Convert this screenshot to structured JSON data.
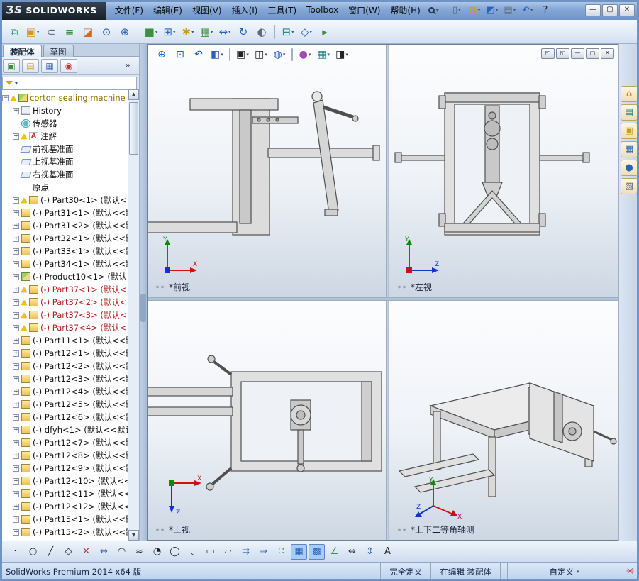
{
  "titlebar": {
    "logo_mark": "ƷS",
    "logo_text": "SOLIDWORKS",
    "menus": [
      {
        "label": "文件(F)"
      },
      {
        "label": "编辑(E)"
      },
      {
        "label": "视图(V)"
      },
      {
        "label": "插入(I)"
      },
      {
        "label": "工具(T)"
      },
      {
        "label": "Toolbox"
      },
      {
        "label": "窗口(W)"
      },
      {
        "label": "帮助(H)"
      }
    ],
    "quick_icons": [
      {
        "name": "new-document-icon",
        "g": "▯",
        "cls": "c-gray dd"
      },
      {
        "name": "open-icon",
        "g": "▥",
        "cls": "c-yellow dd"
      },
      {
        "name": "save-icon",
        "g": "◩",
        "cls": "c-blue dd"
      },
      {
        "name": "print-icon",
        "g": "▤",
        "cls": "c-gray dd"
      },
      {
        "name": "undo-icon",
        "g": "↶",
        "cls": "c-blue dd"
      },
      {
        "name": "help-icon",
        "g": "?",
        "cls": "c-dark"
      }
    ],
    "window_controls": [
      {
        "name": "minimize-button",
        "g": "—"
      },
      {
        "name": "maximize-button",
        "g": "▢"
      },
      {
        "name": "close-button",
        "g": "✕"
      }
    ]
  },
  "toolbar": {
    "icons": [
      {
        "name": "window-cascade-icon",
        "g": "⧉",
        "cls": "c-teal"
      },
      {
        "name": "open-folder-icon",
        "g": "▣",
        "cls": "c-yellow dd"
      },
      {
        "name": "attach-icon",
        "g": "⊂",
        "cls": "c-gray"
      },
      {
        "name": "external-references-icon",
        "g": "≡",
        "cls": "c-green"
      },
      {
        "name": "edit-component-icon",
        "g": "◪",
        "cls": "c-orange"
      },
      {
        "name": "find-references-icon",
        "g": "⊙",
        "cls": "c-blue"
      },
      {
        "name": "search-doc-icon",
        "g": "⊕",
        "cls": "c-blue"
      },
      {
        "name": "separator",
        "g": "",
        "cls": "sep"
      },
      {
        "name": "insert-components-icon",
        "g": "■",
        "cls": "c-green dd"
      },
      {
        "name": "mate-icon",
        "g": "⊞",
        "cls": "c-blue dd"
      },
      {
        "name": "smart-fasteners-icon",
        "g": "✱",
        "cls": "c-yellow dd"
      },
      {
        "name": "component-pattern-icon",
        "g": "▦",
        "cls": "c-green dd"
      },
      {
        "name": "move-component-icon",
        "g": "↔",
        "cls": "c-blue dd"
      },
      {
        "name": "rotate-component-icon",
        "g": "↻",
        "cls": "c-blue"
      },
      {
        "name": "show-hidden-components-icon",
        "g": "◐",
        "cls": "c-gray"
      },
      {
        "name": "separator",
        "g": "",
        "cls": "sep"
      },
      {
        "name": "assembly-features-icon",
        "g": "⊟",
        "cls": "c-teal dd"
      },
      {
        "name": "reference-geometry-icon",
        "g": "◇",
        "cls": "c-blue dd"
      },
      {
        "name": "motion-study-icon",
        "g": "▸",
        "cls": "c-green"
      }
    ]
  },
  "panel": {
    "tabs": [
      {
        "label": "装配体",
        "cls": "active"
      },
      {
        "label": "草图",
        "cls": ""
      }
    ],
    "header_icons": [
      {
        "name": "featuremanager-tab-icon",
        "g": "▣",
        "cls": "c-green"
      },
      {
        "name": "propertymanager-tab-icon",
        "g": "▤",
        "cls": "c-yellow"
      },
      {
        "name": "configurationmanager-tab-icon",
        "g": "▦",
        "cls": "c-blue"
      },
      {
        "name": "dimxpertmanager-tab-icon",
        "g": "◉",
        "cls": "c-red"
      },
      {
        "name": "chevron-right-icon",
        "g": "»",
        "cls": "chev"
      }
    ],
    "tree": {
      "items": [
        {
          "label": "corton sealing machine",
          "cls": "i-asmroot warn root exp"
        },
        {
          "label": "History",
          "cls": "i-history exp"
        },
        {
          "label": "传感器",
          "cls": "i-sensor"
        },
        {
          "label": "注解",
          "cls": "i-ann warn exp"
        },
        {
          "label": "前视基准面",
          "cls": "i-plane"
        },
        {
          "label": "上视基准面",
          "cls": "i-plane"
        },
        {
          "label": "右视基准面",
          "cls": "i-plane"
        },
        {
          "label": "原点",
          "cls": "i-origin"
        },
        {
          "label": "(-) Part30<1> (默认<",
          "cls": "i-part warn exp"
        },
        {
          "label": "(-) Part31<1> (默认<<默",
          "cls": "i-part exp"
        },
        {
          "label": "(-) Part31<2> (默认<<默",
          "cls": "i-part exp"
        },
        {
          "label": "(-) Part32<1> (默认<<默",
          "cls": "i-part exp"
        },
        {
          "label": "(-) Part33<1> (默认<<默",
          "cls": "i-part exp"
        },
        {
          "label": "(-) Part34<1> (默认<<默",
          "cls": "i-part exp"
        },
        {
          "label": "(-) Product10<1> (默认<",
          "cls": "i-asm exp"
        },
        {
          "label": "(-) Part37<1> (默认<",
          "cls": "i-part warn red exp"
        },
        {
          "label": "(-) Part37<2> (默认<",
          "cls": "i-part warn red exp"
        },
        {
          "label": "(-) Part37<3> (默认<",
          "cls": "i-part warn red exp"
        },
        {
          "label": "(-) Part37<4> (默认<",
          "cls": "i-part warn red exp"
        },
        {
          "label": "(-) Part11<1> (默认<<默",
          "cls": "i-part exp"
        },
        {
          "label": "(-) Part12<1> (默认<<默",
          "cls": "i-part exp"
        },
        {
          "label": "(-) Part12<2> (默认<<默",
          "cls": "i-part exp"
        },
        {
          "label": "(-) Part12<3> (默认<<默",
          "cls": "i-part exp"
        },
        {
          "label": "(-) Part12<4> (默认<<默",
          "cls": "i-part exp"
        },
        {
          "label": "(-) Part12<5> (默认<<默",
          "cls": "i-part exp"
        },
        {
          "label": "(-) Part12<6> (默认<<默",
          "cls": "i-part exp"
        },
        {
          "label": "(-) dfyh<1> (默认<<默认",
          "cls": "i-part exp"
        },
        {
          "label": "(-) Part12<7> (默认<<默",
          "cls": "i-part exp"
        },
        {
          "label": "(-) Part12<8> (默认<<默",
          "cls": "i-part exp"
        },
        {
          "label": "(-) Part12<9> (默认<<默",
          "cls": "i-part exp"
        },
        {
          "label": "(-) Part12<10> (默认<<",
          "cls": "i-part exp"
        },
        {
          "label": "(-) Part12<11> (默认<<",
          "cls": "i-part exp"
        },
        {
          "label": "(-) Part12<12> (默认<<",
          "cls": "i-part exp"
        },
        {
          "label": "(-) Part15<1> (默认<<默",
          "cls": "i-part exp"
        },
        {
          "label": "(-) Part15<2> (默认<<默",
          "cls": "i-part exp"
        }
      ]
    }
  },
  "headsup": [
    {
      "name": "zoom-fit-icon",
      "g": "⊕",
      "cls": "c-blue"
    },
    {
      "name": "zoom-area-icon",
      "g": "⊡",
      "cls": "c-blue"
    },
    {
      "name": "previous-view-icon",
      "g": "↶",
      "cls": "c-blue"
    },
    {
      "name": "section-view-icon",
      "g": "◧",
      "cls": "c-blue dd"
    },
    {
      "name": "separator",
      "g": "",
      "cls": "sep"
    },
    {
      "name": "view-orientation-icon",
      "g": "▣",
      "cls": "c-dark dd"
    },
    {
      "name": "display-style-icon",
      "g": "◫",
      "cls": "c-dark dd"
    },
    {
      "name": "hide-show-items-icon",
      "g": "◍",
      "cls": "c-blue dd"
    },
    {
      "name": "separator",
      "g": "",
      "cls": "sep"
    },
    {
      "name": "edit-appearance-icon",
      "g": "●",
      "cls": "c-multi dd"
    },
    {
      "name": "apply-scene-icon",
      "g": "▦",
      "cls": "c-teal dd"
    },
    {
      "name": "view-settings-icon",
      "g": "◨",
      "cls": "c-dark dd"
    }
  ],
  "docwin": [
    {
      "name": "tile-horizontal-icon",
      "g": "◰"
    },
    {
      "name": "tile-vertical-icon",
      "g": "◱"
    },
    {
      "name": "minimize-doc-icon",
      "g": "—"
    },
    {
      "name": "restore-doc-icon",
      "g": "▢"
    },
    {
      "name": "close-doc-icon",
      "g": "✕"
    }
  ],
  "taskpane": [
    {
      "name": "solidworks-resources-icon",
      "g": "⌂",
      "cls": "c-orange"
    },
    {
      "name": "design-library-icon",
      "g": "▤",
      "cls": "c-teal"
    },
    {
      "name": "file-explorer-icon",
      "g": "▣",
      "cls": "c-yellow"
    },
    {
      "name": "view-palette-icon",
      "g": "▦",
      "cls": "c-blue"
    },
    {
      "name": "appearances-icon",
      "g": "●",
      "cls": "c-blue"
    },
    {
      "name": "custom-properties-icon",
      "g": "▧",
      "cls": "c-gray"
    }
  ],
  "bottombar": [
    {
      "name": "sketch-point-icon",
      "g": "·",
      "cls": "c-dark"
    },
    {
      "name": "circle-icon",
      "g": "○",
      "cls": "c-dark"
    },
    {
      "name": "line-icon",
      "g": "╱",
      "cls": "c-dark"
    },
    {
      "name": "polygon-icon",
      "g": "◇",
      "cls": "c-dark"
    },
    {
      "name": "trim-entities-icon",
      "g": "✕",
      "cls": "c-red"
    },
    {
      "name": "mirror-entities-icon",
      "g": "↔",
      "cls": "c-blue"
    },
    {
      "name": "tangent-arc-icon",
      "g": "◠",
      "cls": "c-dark"
    },
    {
      "name": "spline-icon",
      "g": "≈",
      "cls": "c-dark"
    },
    {
      "name": "centerpoint-arc-icon",
      "g": "◔",
      "cls": "c-dark"
    },
    {
      "name": "ellipse-icon",
      "g": "◯",
      "cls": "c-dark"
    },
    {
      "name": "sketch-fillet-icon",
      "g": "◟",
      "cls": "c-dark"
    },
    {
      "name": "corner-rectangle-icon",
      "g": "▭",
      "cls": "c-dark"
    },
    {
      "name": "parallelogram-icon",
      "g": "▱",
      "cls": "c-dark"
    },
    {
      "name": "convert-entities-icon",
      "g": "⇉",
      "cls": "c-blue"
    },
    {
      "name": "offset-entities-icon",
      "g": "⇒",
      "cls": "c-blue"
    },
    {
      "name": "linear-sketch-pattern-icon",
      "g": "∷",
      "cls": "c-green"
    },
    {
      "name": "grid-icon",
      "g": "▦",
      "cls": "c-blue active"
    },
    {
      "name": "snap-icon",
      "g": "▩",
      "cls": "c-blue active"
    },
    {
      "name": "angle-icon",
      "g": "∠",
      "cls": "c-green"
    },
    {
      "name": "smart-dimension-icon",
      "g": "⇔",
      "cls": "c-dark"
    },
    {
      "name": "vertical-dimension-icon",
      "g": "⇕",
      "cls": "c-blue"
    },
    {
      "name": "text-icon",
      "g": "A",
      "cls": "c-dark"
    }
  ],
  "viewports": [
    {
      "label": "*前视"
    },
    {
      "label": "*左视"
    },
    {
      "label": "*上视"
    },
    {
      "label": "*上下二等角轴测"
    }
  ],
  "axes": {
    "x": "X",
    "y": "Y",
    "z": "Z"
  },
  "statusbar": {
    "product": "SolidWorks Premium 2014 x64 版",
    "defined": "完全定义",
    "editing": "在编辑 装配体",
    "custom": "自定义",
    "logo_glyph": "✳"
  }
}
